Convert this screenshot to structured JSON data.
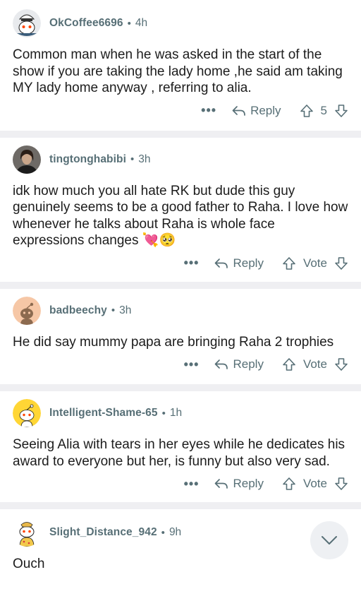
{
  "comments": [
    {
      "username": "OkCoffee6696",
      "age": "4h",
      "text": "Common man when he was asked in the start of the show if you are taking the lady home ,he said am taking MY lady home anyway , referring to alia.",
      "reply_label": "Reply",
      "score": "5",
      "avatar": "snoo-avatar-chef"
    },
    {
      "username": "tingtonghabibi",
      "age": "3h",
      "text": "idk how much you all hate RK but dude this guy genuinely seems to be a good father to Raha. I love how whenever he talks about Raha is whole face expressions changes",
      "emojis": [
        "💘",
        "🥺"
      ],
      "reply_label": "Reply",
      "score": "Vote",
      "avatar": "photo-avatar"
    },
    {
      "username": "badbeechy",
      "age": "3h",
      "text": "He did say mummy papa are bringing Raha 2 trophies",
      "reply_label": "Reply",
      "score": "Vote",
      "avatar": "snoo-avatar-peach"
    },
    {
      "username": "Intelligent-Shame-65",
      "age": "1h",
      "text": "Seeing Alia with tears in her eyes while he dedicates his award to everyone but her, is funny but also very sad.",
      "reply_label": "Reply",
      "score": "Vote",
      "avatar": "snoo-avatar-yellow"
    },
    {
      "username": "Slight_Distance_942",
      "age": "9h",
      "text": "Ouch",
      "avatar": "snoo-avatar-costume"
    }
  ],
  "separator": "•",
  "more_label": "•••",
  "colors": {
    "meta": "#576f76",
    "text": "#1c1c1c",
    "divider": "#efeff2"
  }
}
